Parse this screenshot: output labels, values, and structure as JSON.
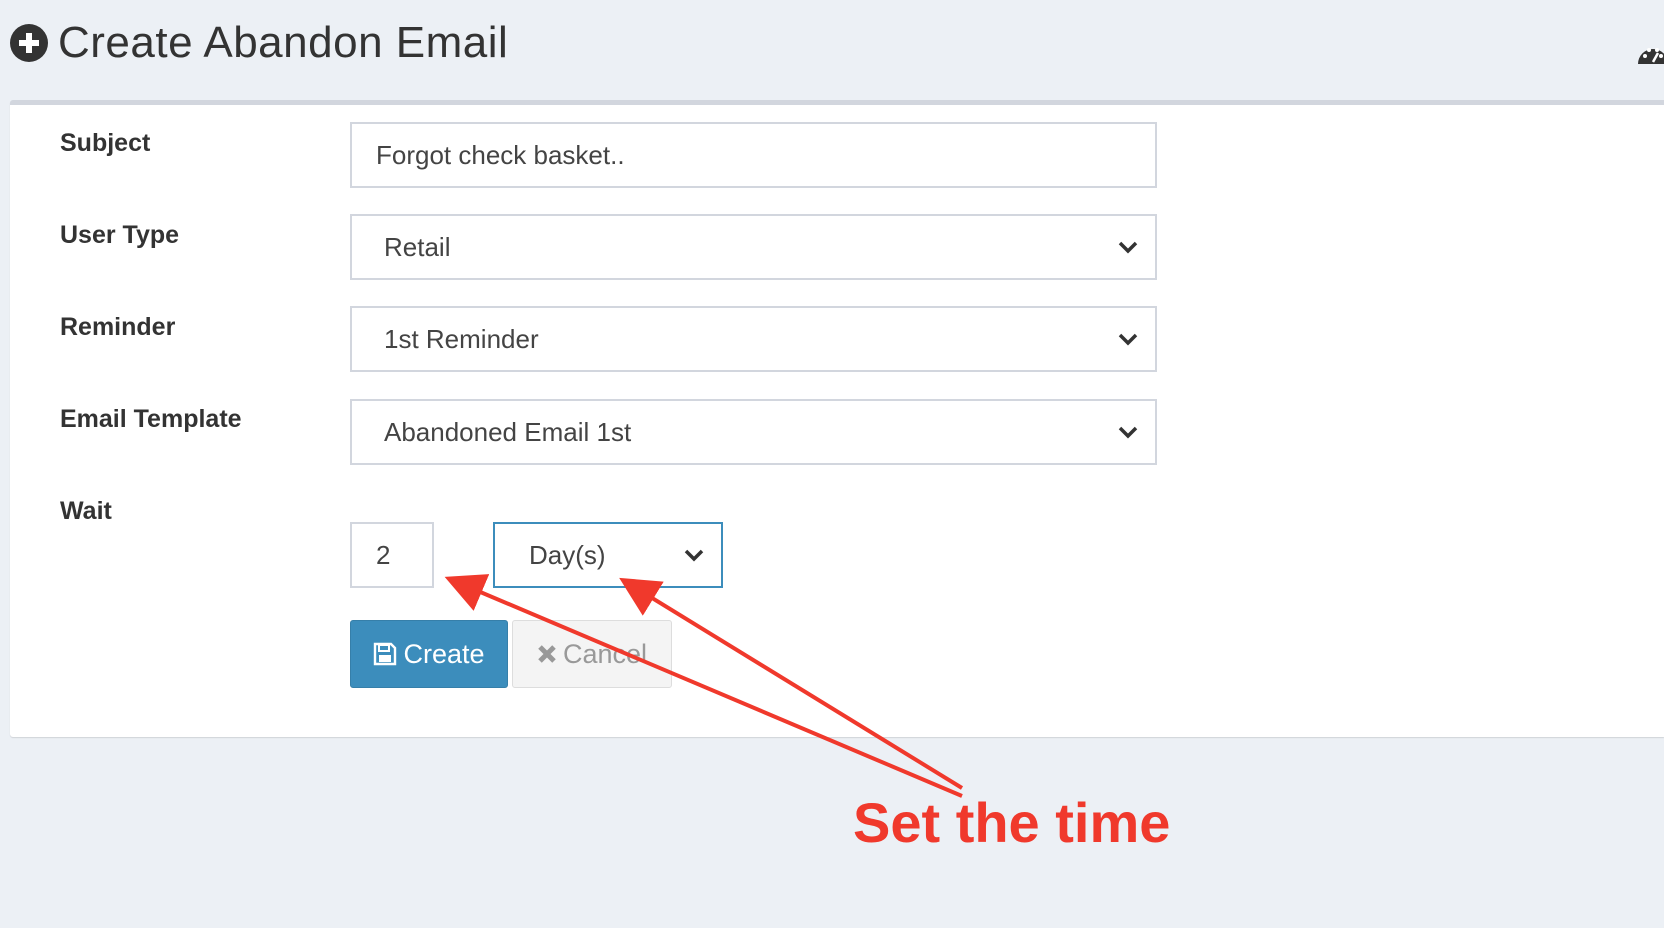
{
  "header": {
    "title": "Create Abandon Email",
    "title_icon": "plus-circle-icon",
    "right_icon": "dashboard-icon"
  },
  "form": {
    "subject": {
      "label": "Subject",
      "value": "Forgot check basket.."
    },
    "user_type": {
      "label": "User Type",
      "value": "Retail"
    },
    "reminder": {
      "label": "Reminder",
      "value": "1st Reminder"
    },
    "email_template": {
      "label": "Email Template",
      "value": "Abandoned Email 1st"
    },
    "wait": {
      "label": "Wait",
      "amount": "2",
      "unit": "Day(s)"
    }
  },
  "buttons": {
    "create": "Create",
    "create_icon": "save-icon",
    "cancel": "Cancel",
    "cancel_icon": "close-icon"
  },
  "annotation": {
    "text": "Set the time",
    "color": "#f0392c"
  },
  "colors": {
    "primary": "#3c8dbc",
    "background": "#ecf0f5"
  }
}
